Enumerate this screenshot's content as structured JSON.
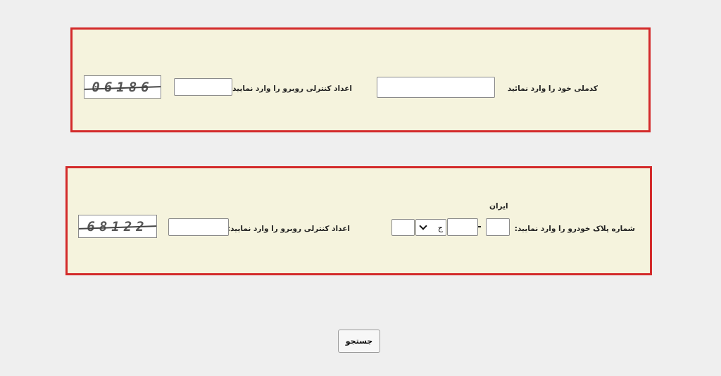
{
  "section_national_id": {
    "national_id_label": "کدملی خود را وارد نمائید",
    "national_id_value": "",
    "captcha_label": "اعداد کنترلی روبرو را وارد نمایید:",
    "captcha_value": "",
    "captcha_image_text": "06186"
  },
  "section_plate": {
    "country_label": "ایران",
    "plate_label": "شماره پلاک خودرو را وارد نمایید:",
    "plate_region_value": "",
    "plate_three_digit_value": "",
    "plate_letter_selected": "ج",
    "plate_two_digit_value": "",
    "plate_separator": "-",
    "captcha_label": "اعداد کنترلی روبرو را وارد نمایید:",
    "captcha_value": "",
    "captcha_image_text": "68122"
  },
  "actions": {
    "search_label": "جستجو"
  },
  "colors": {
    "panel_border": "#d32a2a",
    "panel_background": "#f5f3dd",
    "page_background": "#efefef"
  }
}
